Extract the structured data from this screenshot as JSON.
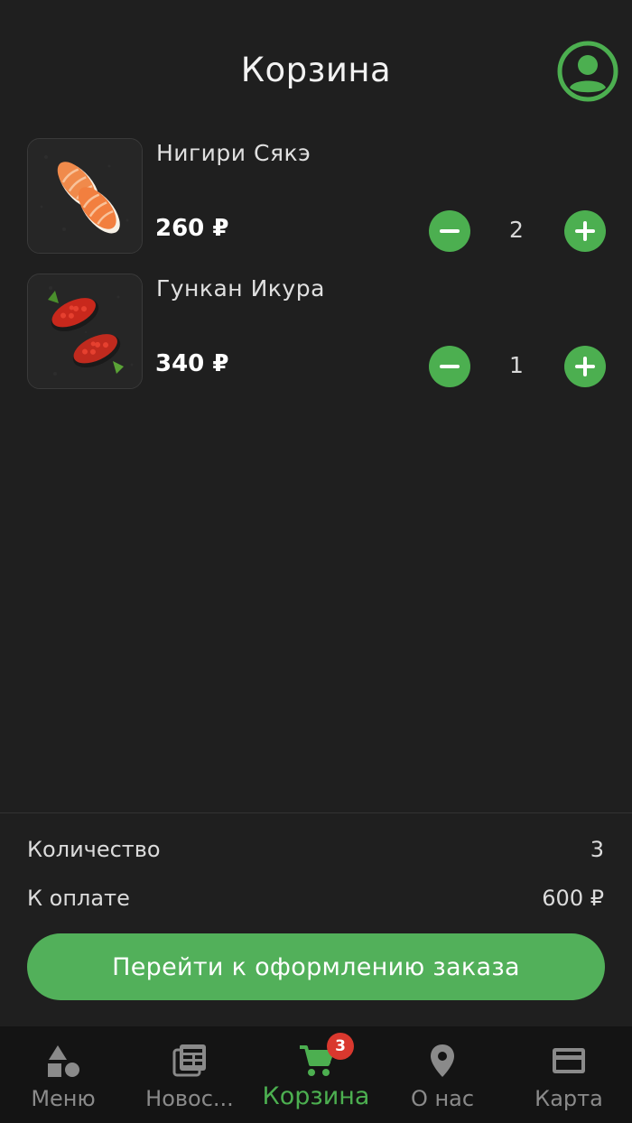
{
  "header": {
    "title": "Корзина",
    "profile_icon": "user-circle-icon"
  },
  "cart": {
    "items": [
      {
        "name": "Нигири Сякэ",
        "price": "260 ₽",
        "quantity": "2",
        "image": "salmon-nigiri-image"
      },
      {
        "name": "Гункан Икура",
        "price": "340 ₽",
        "quantity": "1",
        "image": "ikura-gunkan-image"
      }
    ]
  },
  "summary": {
    "quantity_label": "Количество",
    "quantity_value": "3",
    "total_label": "К оплате",
    "total_value": "600 ₽",
    "checkout_label": "Перейти к оформлению заказа"
  },
  "nav": {
    "items": [
      {
        "label": "Меню",
        "icon": "shapes-icon"
      },
      {
        "label": "Новос...",
        "icon": "news-icon"
      },
      {
        "label": "Корзина",
        "icon": "cart-icon",
        "badge": "3",
        "active": true
      },
      {
        "label": "О нас",
        "icon": "location-pin-icon"
      },
      {
        "label": "Карта",
        "icon": "credit-card-icon"
      }
    ]
  },
  "colors": {
    "background": "#1f1f1f",
    "accent": "#4caf50",
    "badge": "#d9382e",
    "nav_background": "#141414"
  }
}
